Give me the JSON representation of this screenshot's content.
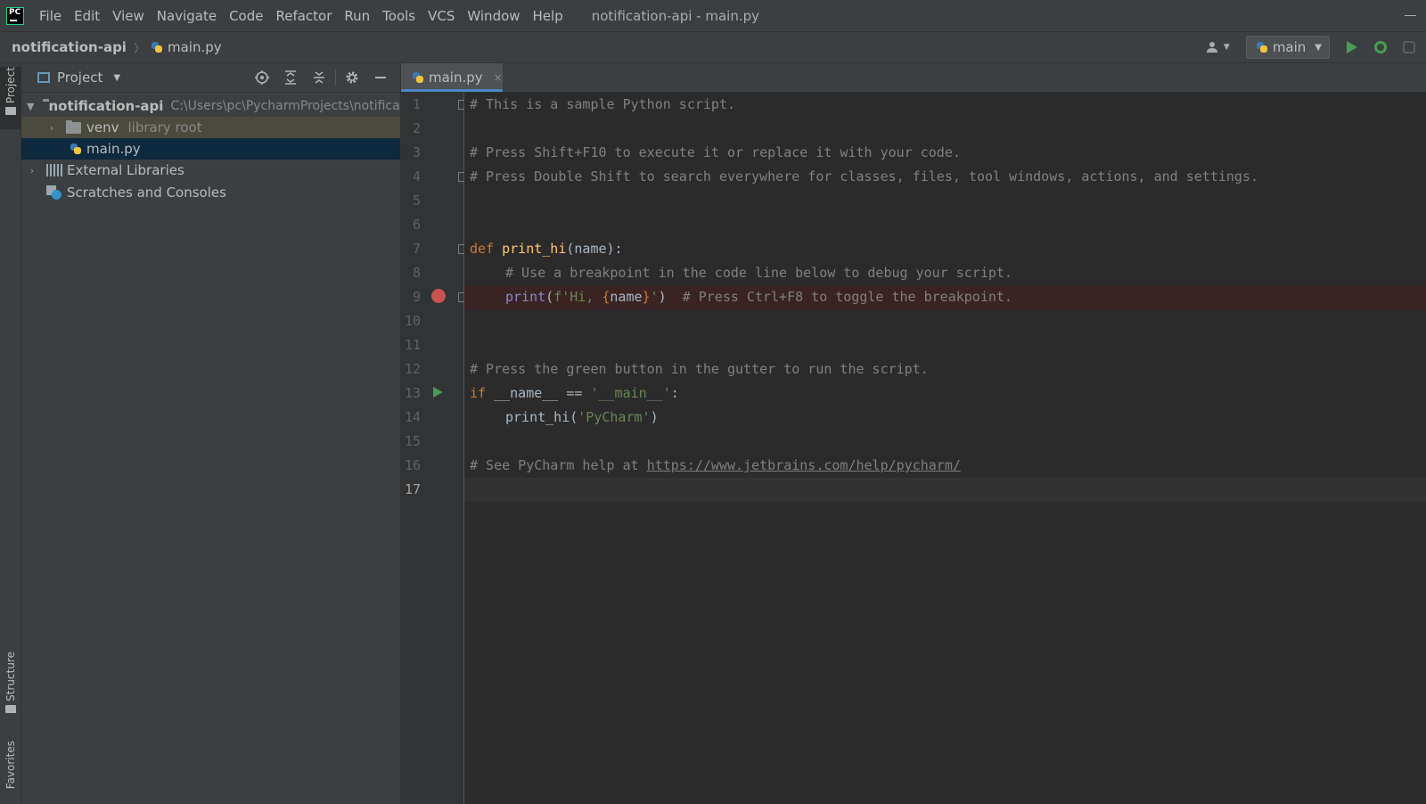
{
  "titlebar": {
    "logo": "PC",
    "menu": [
      "File",
      "Edit",
      "View",
      "Navigate",
      "Code",
      "Refactor",
      "Run",
      "Tools",
      "VCS",
      "Window",
      "Help"
    ],
    "window_title": "notification-api - main.py"
  },
  "navbar": {
    "project": "notification-api",
    "file": "main.py",
    "run_config": "main"
  },
  "side_strip": {
    "project_tab": "Project",
    "structure_tab": "Structure",
    "favorites_tab": "Favorites"
  },
  "project_panel": {
    "title": "Project",
    "tree": {
      "root_name": "notification-api",
      "root_path": "C:\\Users\\pc\\PycharmProjects\\notification-api",
      "venv_name": "venv",
      "venv_tag": "library root",
      "main_file": "main.py",
      "external_libs": "External Libraries",
      "scratches": "Scratches and Consoles"
    }
  },
  "editor": {
    "tab_name": "main.py",
    "close_glyph": "×",
    "line_numbers": [
      "1",
      "2",
      "3",
      "4",
      "5",
      "6",
      "7",
      "8",
      "9",
      "10",
      "11",
      "12",
      "13",
      "14",
      "15",
      "16",
      "17"
    ],
    "current_line": 17,
    "breakpoint_line": 9,
    "run_gutter_line": 13,
    "code": {
      "l1": "# This is a sample Python script.",
      "l3": "# Press Shift+F10 to execute it or replace it with your code.",
      "l4": "# Press Double Shift to search everywhere for classes, files, tool windows, actions, and settings.",
      "l7_kw": "def",
      "l7_fn": "print_hi",
      "l7_rest": "(name):",
      "l8": "# Use a breakpoint in the code line below to debug your script.",
      "l9_fn": "print",
      "l9_p1": "(",
      "l9_s1": "f'Hi, ",
      "l9_b1": "{",
      "l9_var": "name",
      "l9_b2": "}",
      "l9_s2": "'",
      "l9_p2": ")",
      "l9_com": "# Press Ctrl+F8 to toggle the breakpoint.",
      "l12": "# Press the green button in the gutter to run the script.",
      "l13_kw": "if",
      "l13_rest": " __name__ == ",
      "l13_str": "'__main__'",
      "l13_colon": ":",
      "l14_fn": "print_hi(",
      "l14_str": "'PyCharm'",
      "l14_end": ")",
      "l16_com": "# See PyCharm help at ",
      "l16_url": "https://www.jetbrains.com/help/pycharm/"
    }
  },
  "colors": {
    "background": "#2b2b2b",
    "panel": "#3c3f41",
    "comment": "#808080",
    "keyword": "#cc7832",
    "function": "#ffc66d",
    "string": "#6a8759",
    "breakpoint": "#c75450",
    "run_green": "#499c54",
    "selection": "#0d293e"
  }
}
